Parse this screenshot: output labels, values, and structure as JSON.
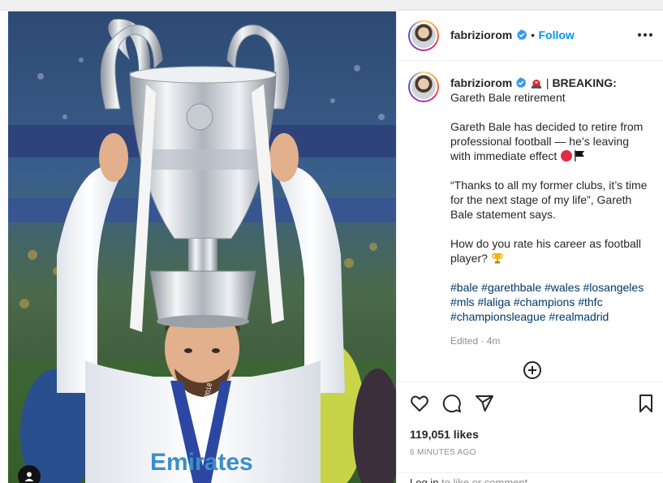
{
  "post": {
    "username": "fabriziorom",
    "follow_label": "Follow",
    "header_separator": "•",
    "caption": {
      "username": "fabriziorom",
      "headline_prefix": " | ",
      "headline_bold": "BREAKING:",
      "headline_rest": " Gareth Bale retirement",
      "paragraph_1": "Gareth Bale has decided to retire from professional football — he’s leaving with immediate effect",
      "paragraph_2": "“Thanks to all my former clubs, it’s time for the next stage of my life”, Gareth Bale statement says.",
      "paragraph_3": "How do you rate his career as football player?",
      "hashtags": [
        "#bale",
        "#garethbale",
        "#wales",
        "#losangeles",
        "#mls",
        "#laliga",
        "#champions",
        "#thfc",
        "#championsleague",
        "#realmadrid"
      ],
      "edited": "Edited · 4m"
    },
    "likes": "119,051 likes",
    "timestamp": "6 MINUTES AGO",
    "login_prompt": {
      "link": "Log in",
      "rest": " to like or comment."
    }
  },
  "photo": {
    "kit_text": "Emirates",
    "lanyard_text": "FINAL KYIV 2018"
  },
  "icons": {
    "verified": "verified-badge-icon",
    "siren": "siren-emoji",
    "red_circle": "red-circle-emoji",
    "flag": "black-flag-emoji",
    "trophy": "trophy-emoji",
    "add_comment": "plus-circle-icon",
    "like": "heart-icon",
    "comment": "comment-icon",
    "share": "paper-plane-icon",
    "save": "bookmark-icon",
    "more": "more-options-icon",
    "user_tag": "user-tag-icon"
  },
  "colors": {
    "link_blue": "#0095f6",
    "hashtag": "#00376b",
    "muted": "#8e8e8e",
    "text": "#262626"
  }
}
